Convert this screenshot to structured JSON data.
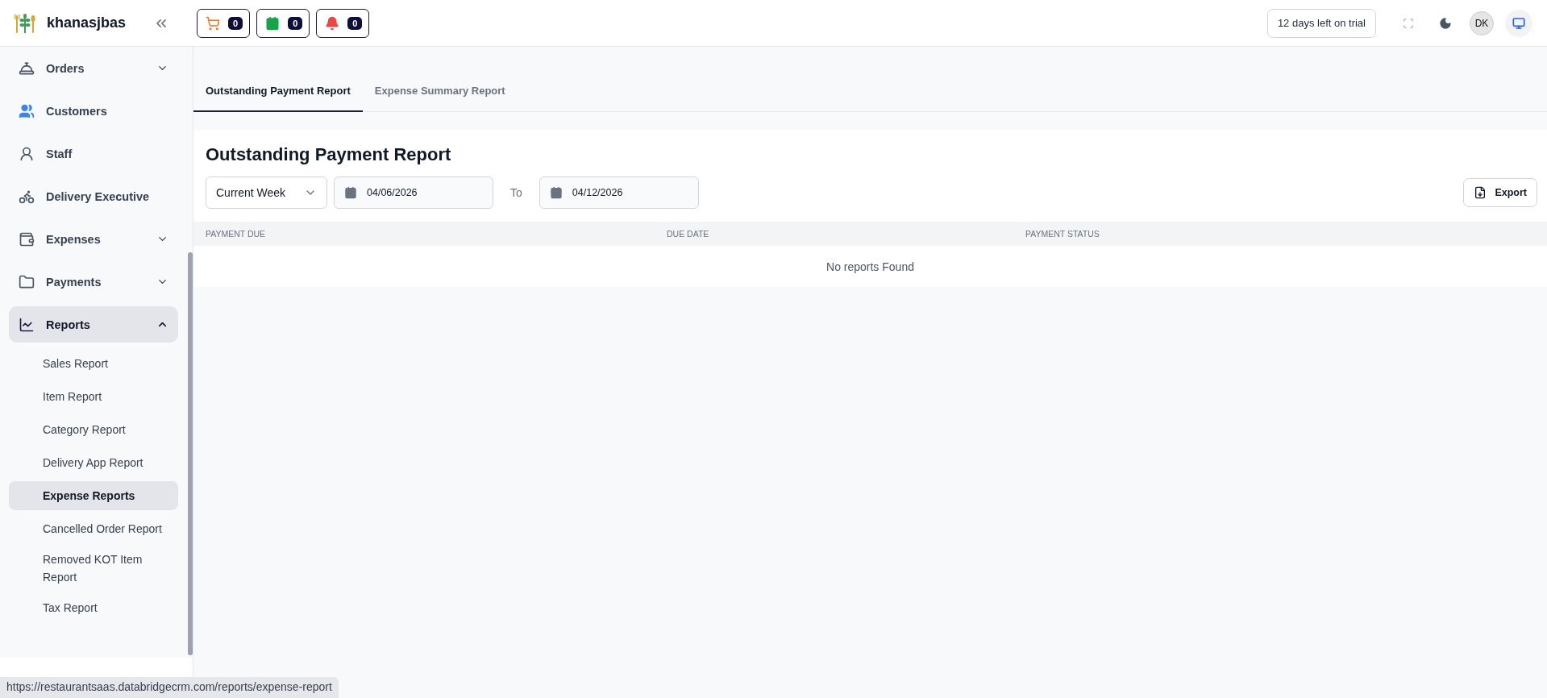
{
  "header": {
    "brand": "khanasjbas",
    "counters": [
      {
        "kind": "cart",
        "count": "0"
      },
      {
        "kind": "calendar",
        "count": "0"
      },
      {
        "kind": "bell",
        "count": "0"
      }
    ],
    "trial": "12 days left on trial",
    "avatar": "DK"
  },
  "sidebar": {
    "items": [
      {
        "kind": "orders",
        "label": "Orders",
        "expanded": false,
        "selected": false
      },
      {
        "kind": "customers",
        "label": "Customers",
        "selected": false
      },
      {
        "kind": "staff",
        "label": "Staff",
        "selected": false
      },
      {
        "kind": "delivery",
        "label": "Delivery Executive",
        "selected": false
      },
      {
        "kind": "expenses",
        "label": "Expenses",
        "expanded": false,
        "selected": false
      },
      {
        "kind": "payments",
        "label": "Payments",
        "expanded": false,
        "selected": false
      },
      {
        "kind": "reports",
        "label": "Reports",
        "expanded": true,
        "selected": true,
        "children": [
          {
            "label": "Sales Report",
            "selected": false
          },
          {
            "label": "Item Report",
            "selected": false
          },
          {
            "label": "Category Report",
            "selected": false
          },
          {
            "label": "Delivery App Report",
            "selected": false
          },
          {
            "label": "Expense Reports",
            "selected": true
          },
          {
            "label": "Cancelled Order Report",
            "selected": false
          },
          {
            "label": "Removed KOT Item Report",
            "selected": false
          },
          {
            "label": "Tax Report",
            "selected": false
          }
        ]
      }
    ]
  },
  "tabs": [
    {
      "label": "Outstanding Payment Report",
      "selected": true
    },
    {
      "label": "Expense Summary Report",
      "selected": false
    }
  ],
  "report": {
    "title": "Outstanding Payment Report",
    "period": "Current Week",
    "from": "04/06/2026",
    "separator": "To",
    "to": "04/12/2026",
    "export": "Export",
    "columns": [
      "PAYMENT DUE",
      "DUE DATE",
      "PAYMENT STATUS"
    ],
    "empty": "No reports Found"
  },
  "status_url": "https://restaurantsaas.databridgecrm.com/reports/expense-report"
}
